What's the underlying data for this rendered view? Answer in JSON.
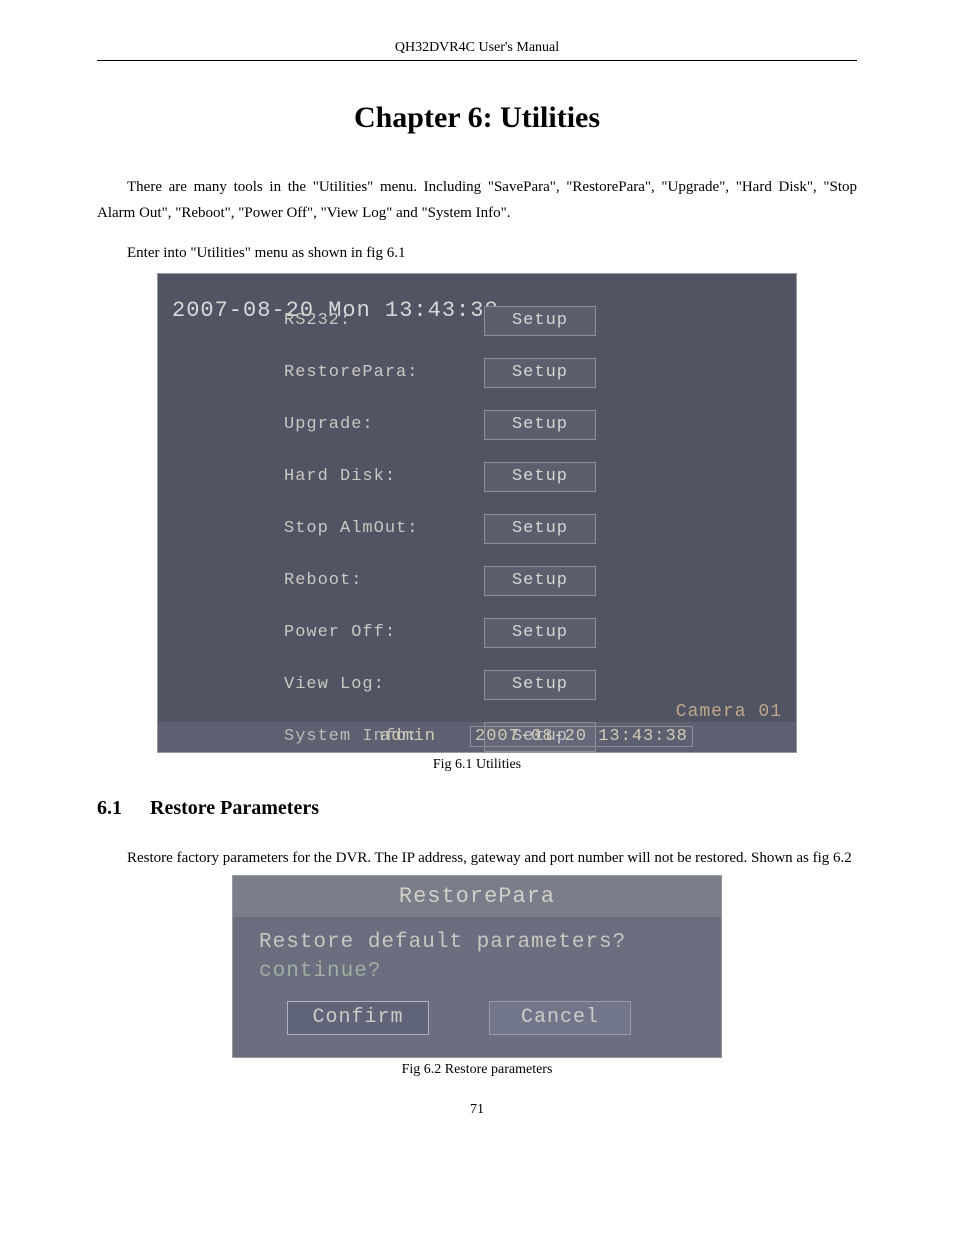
{
  "header": "QH32DVR4C User's Manual",
  "chapter_title": "Chapter 6: Utilities",
  "intro_para": "There are many tools in the \"Utilities\" menu. Including \"SavePara\", \"RestorePara\", \"Upgrade\", \"Hard Disk\", \"Stop Alarm Out\", \"Reboot\", \"Power Off\", \"View Log\" and \"System Info\".",
  "enter_line": "Enter into \"Utilities\" menu as shown in fig 6.1",
  "fig1": {
    "timestamp_overlay": "2007-08-20 Mon 13:43:38",
    "rows": [
      {
        "label": "RS232:",
        "button": "Setup"
      },
      {
        "label": "RestorePara:",
        "button": "Setup"
      },
      {
        "label": "Upgrade:",
        "button": "Setup"
      },
      {
        "label": "Hard Disk:",
        "button": "Setup"
      },
      {
        "label": "Stop AlmOut:",
        "button": "Setup"
      },
      {
        "label": "Reboot:",
        "button": "Setup"
      },
      {
        "label": "Power Off:",
        "button": "Setup"
      },
      {
        "label": "View Log:",
        "button": "Setup"
      },
      {
        "label": "System Info:",
        "button": "Setup"
      }
    ],
    "camera_overlay": "Camera 01",
    "status_user": "admin",
    "status_time": "2007-08-20 13:43:38"
  },
  "caption1": "Fig 6.1 Utilities",
  "section_num": "6.1",
  "section_title": "Restore Parameters",
  "section_para": "Restore factory parameters for the DVR. The IP address, gateway and port number will not be restored. Shown as fig 6.2",
  "fig2": {
    "title": "RestorePara",
    "line1": "Restore default parameters?",
    "line2": "continue?",
    "confirm": "Confirm",
    "cancel": "Cancel"
  },
  "caption2": "Fig 6.2 Restore parameters",
  "page_number": "71"
}
